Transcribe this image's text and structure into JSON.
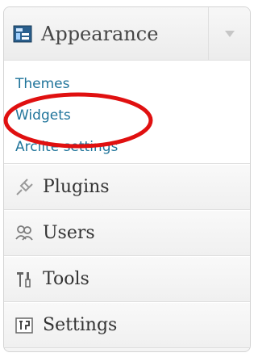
{
  "menu": {
    "appearance": {
      "label": "Appearance",
      "icon": "appearance-icon",
      "toggle_icon": "dropdown-arrow-icon",
      "submenu": [
        {
          "label": "Themes"
        },
        {
          "label": "Widgets"
        },
        {
          "label": "Arclite settings"
        }
      ]
    },
    "items": [
      {
        "label": "Plugins",
        "icon": "plug-icon"
      },
      {
        "label": "Users",
        "icon": "users-icon"
      },
      {
        "label": "Tools",
        "icon": "tools-icon"
      },
      {
        "label": "Settings",
        "icon": "settings-icon"
      }
    ]
  },
  "annotation": {
    "color": "#e01010",
    "target": "Widgets"
  }
}
